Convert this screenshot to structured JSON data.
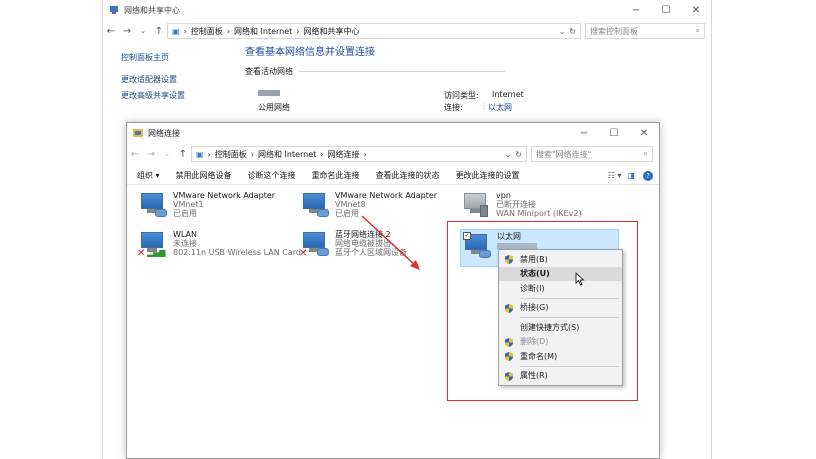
{
  "outer": {
    "title": "网络和共享中心",
    "path": [
      "控制面板",
      "网络和 Internet",
      "网络和共享中心"
    ],
    "search_placeholder": "搜索控制面板",
    "sidebar": [
      "控制面板主页",
      "更改适配器设置",
      "更改高级共享设置"
    ],
    "heading": "查看基本网络信息并设置连接",
    "active_label": "查看活动网络",
    "network_type": "公用网络",
    "access_type_label": "访问类型:",
    "access_type_value": "Internet",
    "connection_label": "连接:",
    "connection_value": "以太网"
  },
  "inner": {
    "title": "网络连接",
    "path": [
      "控制面板",
      "网络和 Internet",
      "网络连接"
    ],
    "search_placeholder": "搜索\"网络连接\"",
    "commands": [
      "组织 ▾",
      "禁用此网络设备",
      "诊断这个连接",
      "重命名此连接",
      "查看此连接的状态",
      "更改此连接的设置"
    ],
    "adapters": [
      {
        "name": "VMware Network Adapter",
        "line2": "VMnet1",
        "line3": "已启用"
      },
      {
        "name": "VMware Network Adapter",
        "line2": "VMnet8",
        "line3": "已启用"
      },
      {
        "name": "vpn",
        "line2": "已断开连接",
        "line3": "WAN Miniport (IKEv2)"
      },
      {
        "name": "WLAN",
        "line2": "未连接",
        "line3": "802.11n USB Wireless LAN Card"
      },
      {
        "name": "蓝牙网络连接 2",
        "line2": "网络电缆被拔出",
        "line3": "蓝牙个人区域网设备"
      },
      {
        "name": "以太网",
        "line2": "",
        "line3": ""
      }
    ]
  },
  "menu": {
    "items": [
      {
        "label": "禁用(B)",
        "shield": true
      },
      {
        "label": "状态(U)",
        "shield": false
      },
      {
        "label": "诊断(I)",
        "shield": false
      },
      {
        "label": "桥接(G)",
        "shield": true
      },
      {
        "label": "创建快捷方式(S)",
        "shield": false
      },
      {
        "label": "删除(D)",
        "shield": true
      },
      {
        "label": "重命名(M)",
        "shield": true
      },
      {
        "label": "属性(R)",
        "shield": true
      }
    ]
  },
  "colors": {
    "highlight": "#cce8ff",
    "annotation": "#e03030",
    "link": "#1e50a0"
  }
}
